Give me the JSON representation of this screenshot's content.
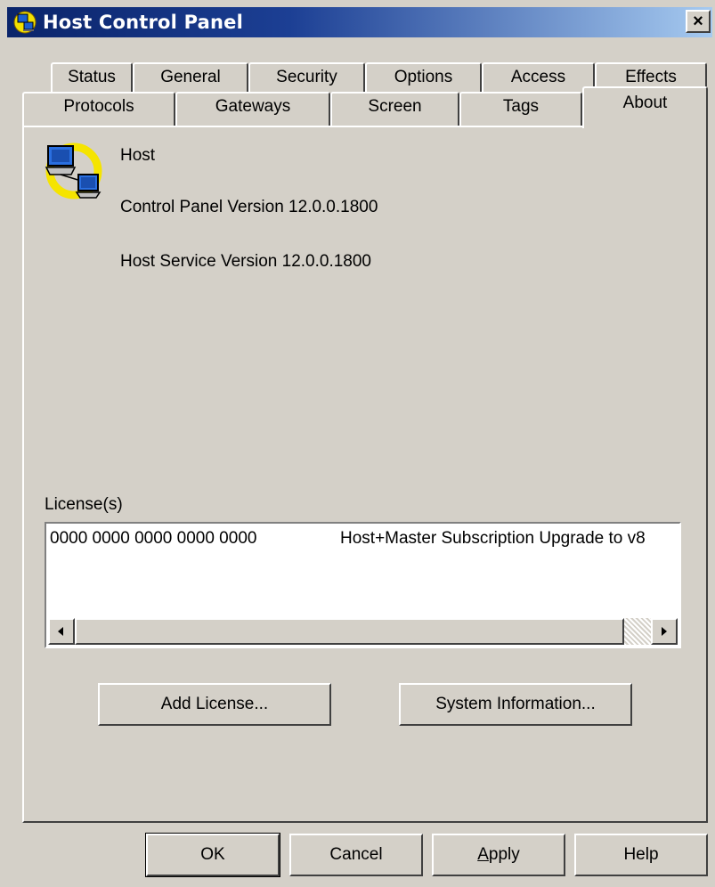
{
  "window": {
    "title": "Host Control Panel",
    "close_symbol": "×"
  },
  "tabs_row_back": [
    {
      "label": "Status"
    },
    {
      "label": "General"
    },
    {
      "label": "Security"
    },
    {
      "label": "Options"
    },
    {
      "label": "Access"
    },
    {
      "label": "Effects"
    }
  ],
  "tabs_row_front": [
    {
      "label": "Protocols"
    },
    {
      "label": "Gateways"
    },
    {
      "label": "Screen"
    },
    {
      "label": "Tags"
    },
    {
      "label": "About",
      "active": true
    }
  ],
  "about": {
    "product_name": "Host",
    "control_panel_version": "Control Panel Version 12.0.0.1800",
    "host_service_version": "Host Service Version 12.0.0.1800",
    "icon": "host-computer-icon"
  },
  "licenses": {
    "label": "License(s)",
    "rows": [
      {
        "key": "0000 0000 0000 0000 0000",
        "description": "Host+Master Subscription Upgrade to v8"
      }
    ]
  },
  "actions": {
    "add_license": "Add License...",
    "system_information": "System Information..."
  },
  "footer": {
    "ok": "OK",
    "cancel": "Cancel",
    "apply": "Apply",
    "help": "Help"
  }
}
